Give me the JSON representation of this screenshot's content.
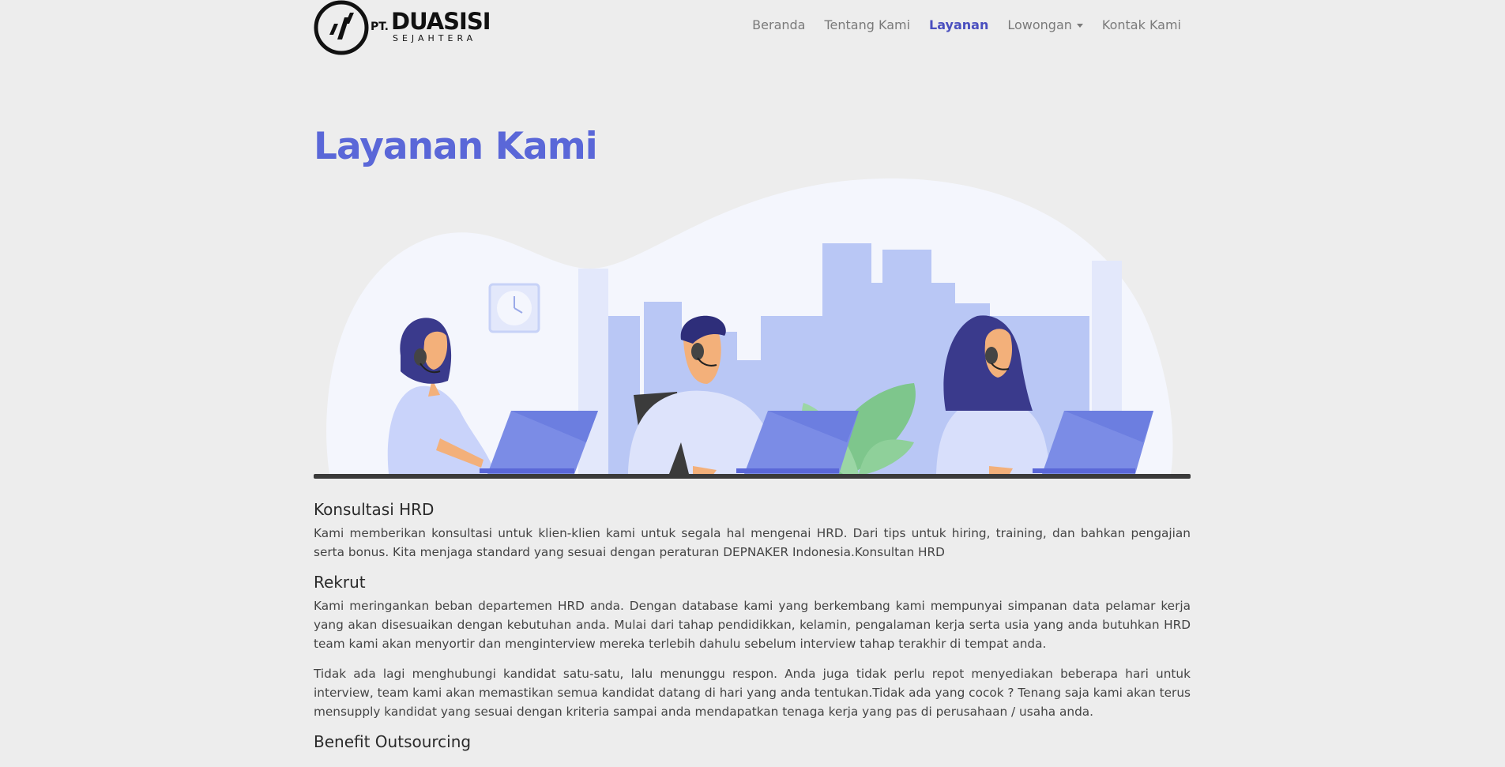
{
  "brand": {
    "pt": "PT.",
    "name": "DUASISI",
    "sub": "SEJAHTERA"
  },
  "nav": {
    "items": [
      {
        "label": "Beranda"
      },
      {
        "label": "Tentang Kami"
      },
      {
        "label": "Layanan"
      },
      {
        "label": "Lowongan"
      },
      {
        "label": "Kontak Kami"
      }
    ]
  },
  "page": {
    "title": "Layanan Kami"
  },
  "sections": {
    "hrd": {
      "heading": "Konsultasi HRD",
      "text": "Kami memberikan konsultasi untuk klien-klien kami untuk segala hal mengenai HRD. Dari tips untuk hiring, training, dan bahkan pengajian serta bonus. Kita menjaga standard yang sesuai dengan peraturan DEPNAKER Indonesia.Konsultan HRD"
    },
    "rekrut": {
      "heading": "Rekrut",
      "text1": "Kami meringankan beban departemen HRD anda. Dengan database kami yang berkembang kami mempunyai simpanan data pelamar kerja yang akan disesuaikan dengan kebutuhan anda. Mulai dari tahap pendidikkan, kelamin, pengalaman kerja serta usia yang anda butuhkan HRD team kami akan menyortir dan menginterview mereka terlebih dahulu sebelum interview tahap terakhir di tempat anda.",
      "text2": "Tidak ada lagi menghubungi kandidat satu-satu, lalu menunggu respon. Anda juga tidak perlu repot menyediakan beberapa hari untuk interview, team kami akan memastikan semua kandidat datang di hari yang anda tentukan.Tidak ada yang cocok ? Tenang saja kami akan terus mensupply kandidat yang sesuai dengan kriteria sampai anda mendapatkan tenaga kerja yang pas di perusahaan / usaha anda."
    },
    "next": {
      "heading": "Benefit Outsourcing"
    }
  },
  "colors": {
    "accent": "#5a67d8",
    "nav_active": "#4a4fbf",
    "background": "#ededed"
  }
}
